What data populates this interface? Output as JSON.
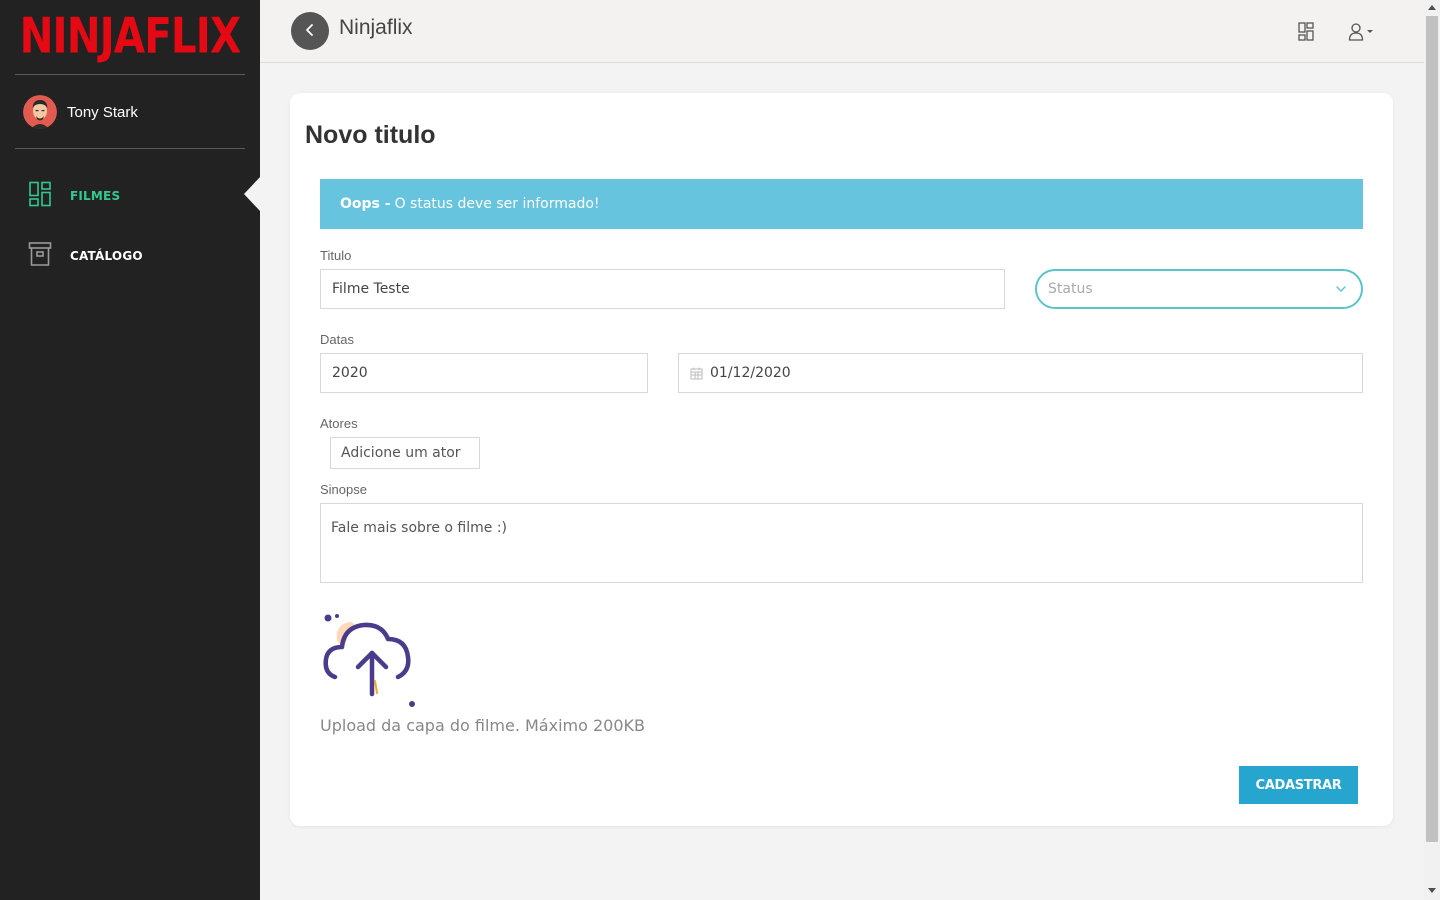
{
  "sidebar": {
    "logo": "NINJAFLIX",
    "user": {
      "name": "Tony Stark"
    },
    "items": [
      {
        "label": "FILMES",
        "icon": "dashboard-grid-icon",
        "active": true,
        "color": "#34c88f"
      },
      {
        "label": "CATÁLOGO",
        "icon": "archive-box-icon",
        "active": false,
        "color": "#ffffff"
      }
    ]
  },
  "header": {
    "title": "Ninjaflix",
    "icons": [
      "back-arrow-icon",
      "dashboard-grid-icon",
      "user-icon",
      "caret-down-icon"
    ]
  },
  "card": {
    "title": "Novo titulo",
    "alert": {
      "prefix": "Oops -",
      "message": "O status deve ser informado!",
      "color": "#67c4de"
    },
    "titulo": {
      "label": "Titulo",
      "value": "Filme Teste"
    },
    "status": {
      "placeholder": "Status"
    },
    "datas": {
      "label": "Datas",
      "year": "2020",
      "release_date": "01/12/2020"
    },
    "atores": {
      "label": "Atores",
      "placeholder": "Adicione um ator"
    },
    "sinopse": {
      "label": "Sinopse",
      "placeholder": "Fale mais sobre o filme :)"
    },
    "upload": {
      "text": "Upload da capa do filme. Máximo 200KB",
      "icon": "cloud-upload-icon"
    },
    "submit_label": "CADASTRAR"
  },
  "colors": {
    "brand": "#e50914",
    "sidebar_bg": "#222222",
    "active_nav": "#34c88f",
    "button": "#26a6cf",
    "status_border": "#5bc4c9"
  }
}
